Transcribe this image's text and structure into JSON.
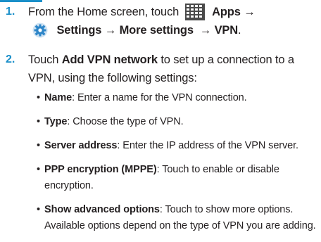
{
  "step1": {
    "number": "1.",
    "line1_prefix": "From the Home screen, touch",
    "apps_label": "Apps",
    "arrow": "→",
    "settings_label": "Settings",
    "more_settings_label": "More settings",
    "vpn_label": "VPN",
    "period": "."
  },
  "step2": {
    "number": "2.",
    "line1_pre": "Touch",
    "add_vpn_label": "Add VPN network",
    "line1_post": "to set up a connection to a",
    "line2": "VPN, using the following settings:"
  },
  "bullets": [
    {
      "term": "Name",
      "desc_line1": ": Enter a name for the VPN connection.",
      "desc_line2": ""
    },
    {
      "term": "Type",
      "desc_line1": ": Choose the type of VPN.",
      "desc_line2": ""
    },
    {
      "term": "Server address",
      "desc_line1": ": Enter the IP address of the VPN server.",
      "desc_line2": ""
    },
    {
      "term": "PPP encryption (MPPE)",
      "desc_line1": ": Touch to enable or disable",
      "desc_line2": "encryption."
    },
    {
      "term": "Show advanced options",
      "desc_line1": ": Touch to show more options.",
      "desc_line2": "Available options depend on the type of VPN you are adding."
    }
  ],
  "bullet_char": "•",
  "icons": {
    "apps": "apps-grid-icon",
    "settings": "settings-gear-icon"
  },
  "colors": {
    "step_number": "#1a8fc9",
    "text": "#231f20",
    "settings_icon": "#2e86c8"
  }
}
